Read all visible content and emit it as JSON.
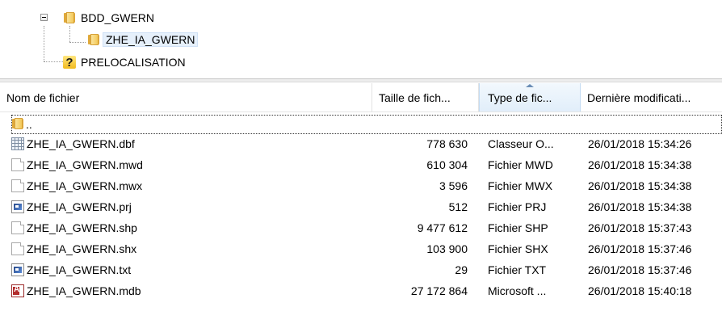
{
  "tree": {
    "items": [
      {
        "label": "BDD_GWERN",
        "icon": "folder-icon",
        "expanded": true
      },
      {
        "label": "ZHE_IA_GWERN",
        "icon": "folder-icon",
        "selected": true
      },
      {
        "label": "PRELOCALISATION",
        "icon": "question-icon"
      }
    ]
  },
  "list": {
    "columns": [
      {
        "label": "Nom de fichier"
      },
      {
        "label": "Taille de fich..."
      },
      {
        "label": "Type de fic...",
        "sorted": "ascending"
      },
      {
        "label": "Dernière modificati..."
      }
    ],
    "parent_entry": {
      "label": "..",
      "icon": "folder-up-icon"
    },
    "rows": [
      {
        "name": "ZHE_IA_GWERN.dbf",
        "size": "778 630",
        "type": "Classeur O...",
        "modified": "26/01/2018 15:34:26",
        "icon": "spreadsheet-file-icon"
      },
      {
        "name": "ZHE_IA_GWERN.mwd",
        "size": "610 304",
        "type": "Fichier MWD",
        "modified": "26/01/2018 15:34:38",
        "icon": "blank-file-icon"
      },
      {
        "name": "ZHE_IA_GWERN.mwx",
        "size": "3 596",
        "type": "Fichier MWX",
        "modified": "26/01/2018 15:34:38",
        "icon": "blank-file-icon"
      },
      {
        "name": "ZHE_IA_GWERN.prj",
        "size": "512",
        "type": "Fichier PRJ",
        "modified": "26/01/2018 15:34:38",
        "icon": "script-file-icon"
      },
      {
        "name": "ZHE_IA_GWERN.shp",
        "size": "9 477 612",
        "type": "Fichier SHP",
        "modified": "26/01/2018 15:37:43",
        "icon": "blank-file-icon"
      },
      {
        "name": "ZHE_IA_GWERN.shx",
        "size": "103 900",
        "type": "Fichier SHX",
        "modified": "26/01/2018 15:37:46",
        "icon": "blank-file-icon"
      },
      {
        "name": "ZHE_IA_GWERN.txt",
        "size": "29",
        "type": "Fichier TXT",
        "modified": "26/01/2018 15:37:46",
        "icon": "script-file-icon"
      },
      {
        "name": "ZHE_IA_GWERN.mdb",
        "size": "27 172 864",
        "type": "Microsoft ...",
        "modified": "26/01/2018 15:40:18",
        "icon": "access-database-icon"
      }
    ]
  },
  "colors": {
    "selection": "#e6f0fb",
    "sorted_header": "#e1eefa",
    "folder": "#f3c95a"
  }
}
